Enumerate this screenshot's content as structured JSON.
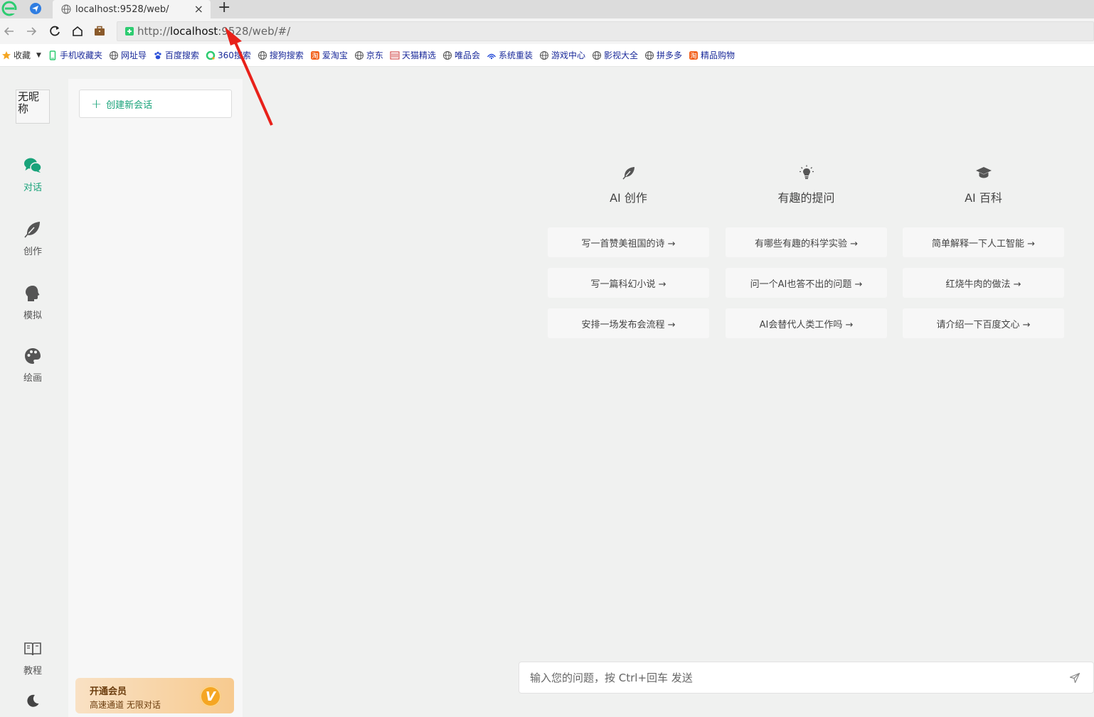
{
  "browser": {
    "tab_title": "localhost:9528/web/",
    "tab_close": "×",
    "new_tab": "+",
    "url_scheme": "http://",
    "url_host": "localhost",
    "url_rest": ":9528/web/#/",
    "bookmarks": [
      {
        "label": "收藏",
        "icon": "star-icon"
      },
      {
        "label": "手机收藏夹",
        "icon": "phone-icon"
      },
      {
        "label": "网址导",
        "icon": "globe-icon"
      },
      {
        "label": "百度搜索",
        "icon": "paw-icon"
      },
      {
        "label": "360搜索",
        "icon": "circle-icon"
      },
      {
        "label": "搜狗搜索",
        "icon": "globe-icon"
      },
      {
        "label": "爱淘宝",
        "icon": "taobao-icon"
      },
      {
        "label": "京东",
        "icon": "globe-icon"
      },
      {
        "label": "天猫精选",
        "icon": "tmall-icon"
      },
      {
        "label": "唯品会",
        "icon": "globe-icon"
      },
      {
        "label": "系统重装",
        "icon": "wifi-icon"
      },
      {
        "label": "游戏中心",
        "icon": "globe-icon"
      },
      {
        "label": "影视大全",
        "icon": "globe-icon"
      },
      {
        "label": "拼多多",
        "icon": "globe-icon"
      },
      {
        "label": "精品购物",
        "icon": "taobao-icon"
      }
    ]
  },
  "rail": {
    "avatar_alt": "无昵称",
    "items": [
      {
        "label": "对话",
        "icon": "chat-icon",
        "active": true
      },
      {
        "label": "创作",
        "icon": "feather-icon",
        "active": false
      },
      {
        "label": "模拟",
        "icon": "head-icon",
        "active": false
      },
      {
        "label": "绘画",
        "icon": "palette-icon",
        "active": false
      }
    ],
    "tutorial_label": "教程"
  },
  "sidebar": {
    "new_chat_label": "创建新会话",
    "vip_title": "开通会员",
    "vip_subtitle": "高速通道 无限对话",
    "vip_badge": "V"
  },
  "main": {
    "columns": [
      {
        "title": "AI 创作",
        "icon": "feather-icon",
        "prompts": [
          "写一首赞美祖国的诗 →",
          "写一篇科幻小说 →",
          "安排一场发布会流程 →"
        ]
      },
      {
        "title": "有趣的提问",
        "icon": "bulb-icon",
        "prompts": [
          "有哪些有趣的科学实验 →",
          "问一个AI也答不出的问题 →",
          "AI会替代人类工作吗 →"
        ]
      },
      {
        "title": "AI 百科",
        "icon": "graduation-cap-icon",
        "prompts": [
          "简单解释一下人工智能 →",
          "红烧牛肉的做法 →",
          "请介绍一下百度文心 →"
        ]
      }
    ],
    "input_placeholder": "输入您的问题，按 Ctrl+回车 发送"
  },
  "colors": {
    "accent": "#19a37a",
    "annotation_arrow": "#e8211a",
    "vip_gradient_start": "#f9e1c4",
    "vip_gradient_end": "#f7ca8f"
  }
}
